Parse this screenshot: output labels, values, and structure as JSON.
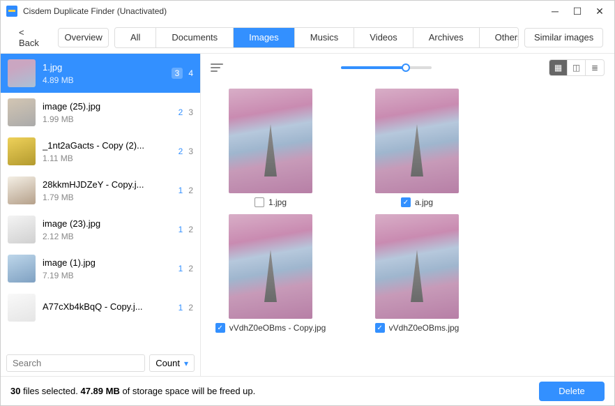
{
  "window": {
    "title": "Cisdem Duplicate Finder (Unactivated)"
  },
  "toolbar": {
    "back": "< Back",
    "overview": "Overview",
    "tabs": {
      "all": "All",
      "documents": "Documents",
      "images": "Images",
      "musics": "Musics",
      "videos": "Videos",
      "archives": "Archives",
      "others": "Others"
    },
    "similar": "Similar images"
  },
  "sidebar": {
    "items": [
      {
        "name": "1.jpg",
        "size": "4.89 MB",
        "b1": "3",
        "b2": "4"
      },
      {
        "name": "image (25).jpg",
        "size": "1.99 MB",
        "b1": "2",
        "b2": "3"
      },
      {
        "name": "_1nt2aGacts - Copy (2)...",
        "size": "1.11 MB",
        "b1": "2",
        "b2": "3"
      },
      {
        "name": "28kkmHJDZeY - Copy.j...",
        "size": "1.79 MB",
        "b1": "1",
        "b2": "2"
      },
      {
        "name": "image (23).jpg",
        "size": "2.12 MB",
        "b1": "1",
        "b2": "2"
      },
      {
        "name": "image (1).jpg",
        "size": "7.19 MB",
        "b1": "1",
        "b2": "2"
      },
      {
        "name": "A77cXb4kBqQ - Copy.j...",
        "size": "",
        "b1": "1",
        "b2": "2"
      }
    ],
    "search_placeholder": "Search",
    "count_label": "Count"
  },
  "grid": {
    "items": [
      {
        "label": "1.jpg",
        "checked": false
      },
      {
        "label": "a.jpg",
        "checked": true
      },
      {
        "label": "vVdhZ0eOBms - Copy.jpg",
        "checked": true
      },
      {
        "label": "vVdhZ0eOBms.jpg",
        "checked": true
      }
    ]
  },
  "footer": {
    "count": "30",
    "t1": " files selected.  ",
    "size": "47.89 MB",
    "t2": "  of storage space will be freed up.",
    "delete": "Delete"
  }
}
